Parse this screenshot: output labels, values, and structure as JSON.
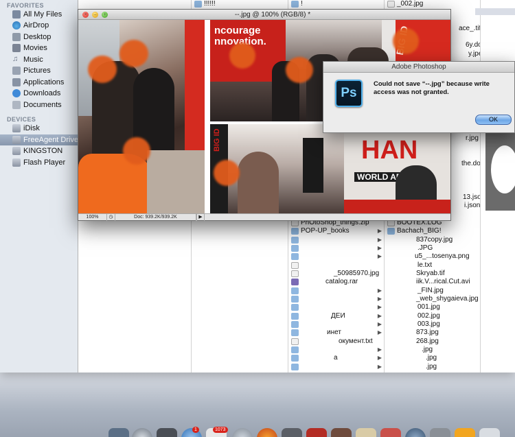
{
  "sidebar": {
    "favorites_header": "FAVORITES",
    "devices_header": "DEVICES",
    "favorites": [
      {
        "label": "All My Files",
        "icon": "all-files-icon"
      },
      {
        "label": "AirDrop",
        "icon": "airdrop-icon"
      },
      {
        "label": "Desktop",
        "icon": "desktop-icon"
      },
      {
        "label": "Movies",
        "icon": "movies-icon"
      },
      {
        "label": "Music",
        "icon": "music-icon"
      },
      {
        "label": "Pictures",
        "icon": "pictures-icon"
      },
      {
        "label": "Applications",
        "icon": "applications-icon"
      },
      {
        "label": "Downloads",
        "icon": "downloads-icon"
      },
      {
        "label": "Documents",
        "icon": "documents-icon"
      }
    ],
    "devices": [
      {
        "label": "iDisk",
        "icon": "idisk-icon"
      },
      {
        "label": "FreeAgent Drive",
        "icon": "drive-icon",
        "selected": true
      },
      {
        "label": "KINGSTON",
        "icon": "drive-icon"
      },
      {
        "label": "Flash Player",
        "icon": "drive-icon"
      }
    ]
  },
  "columns": {
    "col1_top": "!!!!!!",
    "col2_top": "!",
    "col3_top": "_002.jpg",
    "col3_partial": [
      "ace_.tif",
      "6y.doc",
      "y.jpeg",
      "r.jpg",
      "the.doc",
      "13.json",
      "i.json"
    ],
    "col2_items": [
      {
        "label": "PhOtoShop_things.zip",
        "type": "doc"
      },
      {
        "label": "POP-UP_books",
        "type": "folder",
        "arrow": true
      },
      {
        "label": "",
        "type": "folder",
        "arrow": true
      },
      {
        "label": "",
        "type": "folder",
        "arrow": true
      },
      {
        "label": "",
        "type": "doc"
      },
      {
        "label": "_50985970.jpg",
        "type": "doc"
      },
      {
        "label": "catalog.rar",
        "type": "rar"
      },
      {
        "label": "",
        "type": "folder",
        "arrow": true
      },
      {
        "label": "",
        "type": "folder",
        "arrow": true
      },
      {
        "label": "",
        "type": "folder",
        "arrow": true
      },
      {
        "label": "ДЕИ",
        "type": "folder",
        "arrow": true
      },
      {
        "label": "",
        "type": "folder",
        "arrow": true
      },
      {
        "label": "инет",
        "type": "folder",
        "arrow": true
      },
      {
        "label": "окумент.txt",
        "type": "doc"
      },
      {
        "label": "",
        "type": "folder",
        "arrow": true
      },
      {
        "label": "а",
        "type": "folder",
        "arrow": true
      },
      {
        "label": "",
        "type": "folder",
        "arrow": true
      }
    ],
    "col3_items": [
      "BOOTEX.LOG",
      "Bachach_BIG!",
      "837copy.jpg",
      ".JPG",
      "u5_...tosenya.png",
      "le.txt",
      "Skryab.tif",
      "iik.V...rical.Cut.avi",
      "_FIN.jpg",
      "_web_shygaieva.jpg",
      "001.jpg",
      "002.jpg",
      "003.jpg",
      "873.jpg",
      "268.jpg",
      ".jpg",
      ".jpg",
      ".jpg"
    ]
  },
  "photoshop": {
    "doc_title": "--.jpg @ 100% (RGB/8) *",
    "zoom": "100%",
    "doc_size": "Doc: 939.2K/939.2K",
    "banner_texts": [
      "ncourage",
      "nnovation.",
      "BIG ID",
      "HAN",
      "WORLD ARE",
      "BIG ID"
    ]
  },
  "alert": {
    "title": "Adobe Photoshop",
    "logo_text": "Ps",
    "message": "Could not save “--.jpg” because write access was not granted.",
    "ok_label": "OK"
  },
  "dock": {
    "badges": [
      "1",
      "1073"
    ]
  },
  "colors": {
    "sidebar_bg": "#e4e9ef",
    "selection": "#8797ad",
    "ok_button": "#6ea7e6",
    "blur_blob": "#e15c1c"
  }
}
